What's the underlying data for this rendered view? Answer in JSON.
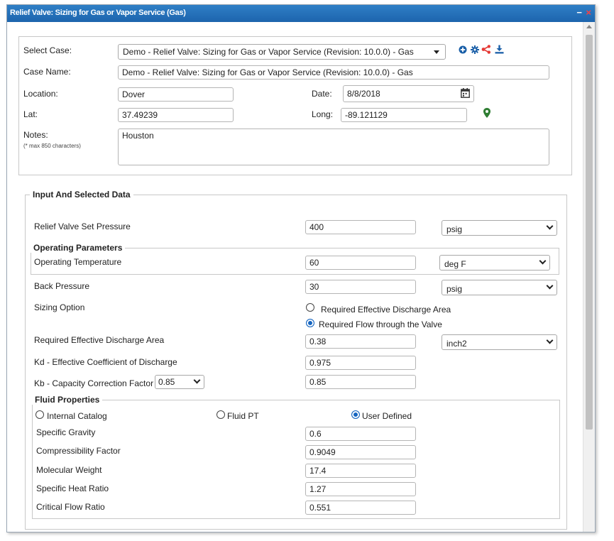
{
  "window": {
    "title": "Relief Valve: Sizing for Gas or Vapor Service (Gas)",
    "minimize": "−",
    "close": "×"
  },
  "case": {
    "select_label": "Select Case:",
    "select_value": "Demo - Relief Valve: Sizing for Gas or Vapor Service (Revision: 10.0.0) - Gas",
    "name_label": "Case Name:",
    "name_value": "Demo - Relief Valve: Sizing for Gas or Vapor Service (Revision: 10.0.0) - Gas",
    "location_label": "Location:",
    "location_value": "Dover",
    "date_label": "Date:",
    "date_value": "8/8/2018",
    "lat_label": "Lat:",
    "lat_value": "37.49239",
    "long_label": "Long:",
    "long_value": "-89.121129",
    "notes_label": "Notes:",
    "notes_hint": "(* max 850 characters)",
    "notes_value": "Houston",
    "icons": [
      "add-icon",
      "gear-icon",
      "share-icon",
      "download-icon",
      "calendar-icon",
      "map-pin-icon"
    ],
    "colors": {
      "add": "#1a5fa8",
      "gear": "#1a5fa8",
      "share": "#e53935",
      "download": "#1a5fa8",
      "pin": "#2e7d32"
    }
  },
  "input": {
    "legend": "Input And Selected Data",
    "set_pressure_label": "Relief Valve Set Pressure",
    "set_pressure_value": "400",
    "set_pressure_unit": "psig",
    "op_params_legend": "Operating Parameters",
    "op_temp_label": "Operating Temperature",
    "op_temp_value": "60",
    "op_temp_unit": "deg F",
    "back_pressure_label": "Back Pressure",
    "back_pressure_value": "30",
    "back_pressure_unit": "psig",
    "sizing_option_label": "Sizing Option",
    "sizing_option_1": "Required Effective Discharge Area",
    "sizing_option_2": "Required Flow through the Valve",
    "sizing_option_selected": 2,
    "discharge_area_label": "Required Effective Discharge Area",
    "discharge_area_value": "0.38",
    "discharge_area_unit": "inch2",
    "kd_label": "Kd - Effective Coefficient of Discharge",
    "kd_value": "0.975",
    "kb_label": "Kb - Capacity Correction Factor",
    "kb_select": "0.85",
    "kb_value": "0.85"
  },
  "fluid": {
    "legend": "Fluid Properties",
    "opt_internal": "Internal Catalog",
    "opt_fluidpt": "Fluid PT",
    "opt_user": "User Defined",
    "selected": "User Defined",
    "sg_label": "Specific Gravity",
    "sg_value": "0.6",
    "z_label": "Compressibility Factor",
    "z_value": "0.9049",
    "mw_label": "Molecular Weight",
    "mw_value": "17.4",
    "k_label": "Specific Heat Ratio",
    "k_value": "1.27",
    "cfr_label": "Critical Flow Ratio",
    "cfr_value": "0.551"
  }
}
